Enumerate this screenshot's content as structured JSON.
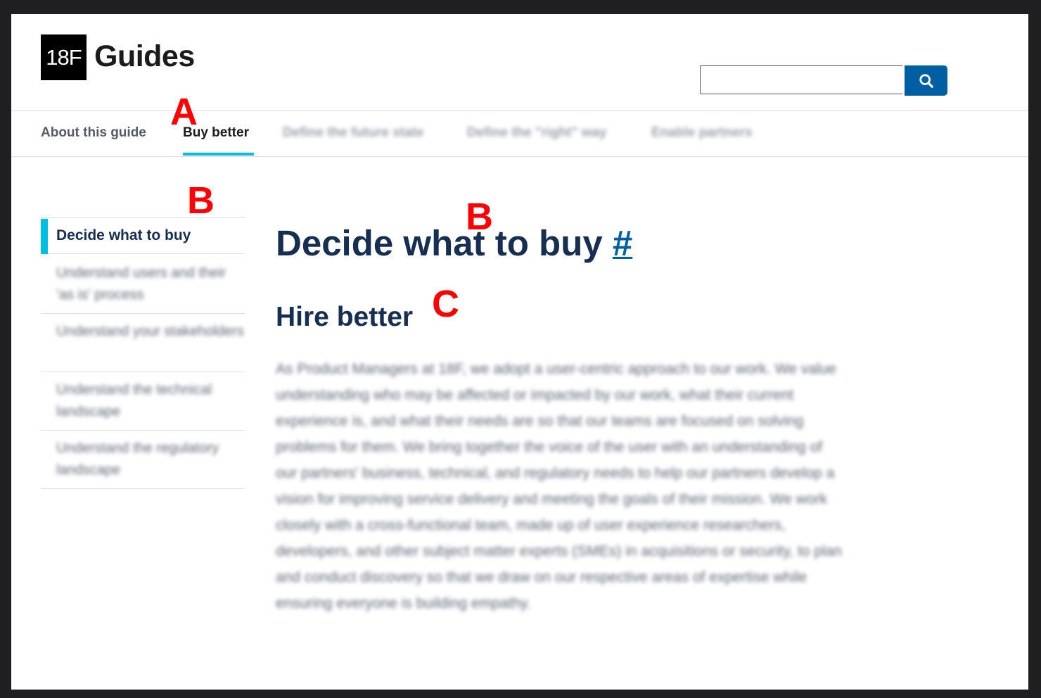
{
  "header": {
    "logo_mark": "18F",
    "logo_text": "Guides",
    "search": {
      "placeholder": "",
      "button_icon": "search-icon"
    }
  },
  "nav": {
    "items": [
      {
        "label": "About this guide"
      },
      {
        "label": "Buy better"
      },
      {
        "label": "Define the future state"
      },
      {
        "label": "Define the \"right\" way"
      },
      {
        "label": "Enable partners"
      }
    ]
  },
  "sidebar": {
    "active": "Decide what to buy",
    "items": [
      {
        "label": "Understand users and their 'as is' process"
      },
      {
        "label": "Understand your stakeholders"
      },
      {
        "label": "Understand the technical landscape"
      },
      {
        "label": "Understand the regulatory landscape"
      }
    ]
  },
  "main": {
    "title": "Decide what to buy",
    "anchor": "#",
    "subtitle": "Hire better",
    "body": "As Product Managers at 18F, we adopt a user-centric approach to our work. We value understanding who may be affected or impacted by our work, what their current experience is, and what their needs are so that our teams are focused on solving problems for them. We bring together the voice of the user with an understanding of our partners' business, technical, and regulatory needs to help our partners develop a vision for improving service delivery and meeting the goals of their mission. We work closely with a cross-functional team, made up of user experience researchers, developers, and other subject matter experts (SMEs) in acquisitions or security, to plan and conduct discovery so that we draw on our respective areas of expertise while ensuring everyone is building empathy."
  },
  "markers": {
    "a": "A",
    "b1": "B",
    "b2": "B",
    "c": "C"
  },
  "colors": {
    "accent": "#00bde3",
    "primary": "#005ea2",
    "heading": "#162e51",
    "marker": "#ff0000"
  }
}
